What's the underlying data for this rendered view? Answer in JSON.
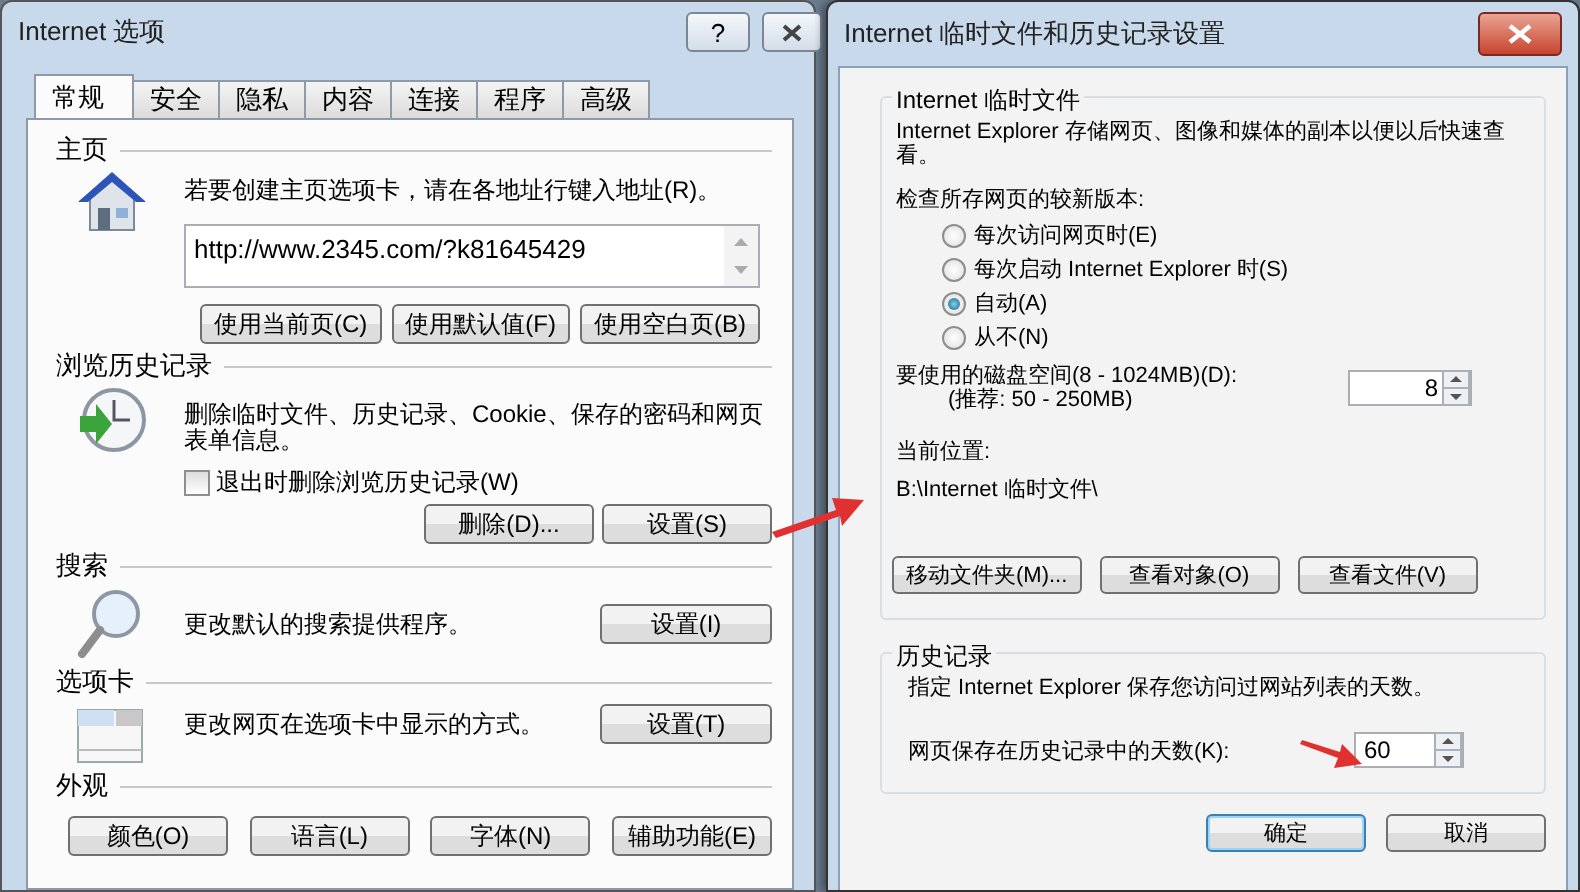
{
  "options_window": {
    "title": "Internet 选项",
    "help_button": "?",
    "tabs": [
      {
        "label": "常规",
        "selected": true
      },
      {
        "label": "安全",
        "selected": false
      },
      {
        "label": "隐私",
        "selected": false
      },
      {
        "label": "内容",
        "selected": false
      },
      {
        "label": "连接",
        "selected": false
      },
      {
        "label": "程序",
        "selected": false
      },
      {
        "label": "高级",
        "selected": false
      }
    ],
    "home_page": {
      "heading": "主页",
      "description": "若要创建主页选项卡，请在各地址行键入地址(R)。",
      "url": "http://www.2345.com/?k81645429",
      "buttons": [
        "使用当前页(C)",
        "使用默认值(F)",
        "使用空白页(B)"
      ]
    },
    "browsing_history": {
      "heading": "浏览历史记录",
      "description": "删除临时文件、历史记录、Cookie、保存的密码和网页表单信息。",
      "checkbox": {
        "label": "退出时删除浏览历史记录(W)",
        "checked": false
      },
      "buttons": [
        "删除(D)...",
        "设置(S)"
      ]
    },
    "search": {
      "heading": "搜索",
      "description": "更改默认的搜索提供程序。",
      "button": "设置(I)"
    },
    "tabs_section": {
      "heading": "选项卡",
      "description": "更改网页在选项卡中显示的方式。",
      "button": "设置(T)"
    },
    "appearance": {
      "heading": "外观",
      "buttons": [
        "颜色(O)",
        "语言(L)",
        "字体(N)",
        "辅助功能(E)"
      ]
    }
  },
  "settings_window": {
    "title": "Internet 临时文件和历史记录设置",
    "temp_files": {
      "heading": "Internet 临时文件",
      "description": "Internet Explorer 存储网页、图像和媒体的副本以便以后快速查看。",
      "check_label": "检查所存网页的较新版本:",
      "radios": [
        {
          "label": "每次访问网页时(E)",
          "selected": false
        },
        {
          "label": "每次启动 Internet Explorer 时(S)",
          "selected": false
        },
        {
          "label": "自动(A)",
          "selected": true
        },
        {
          "label": "从不(N)",
          "selected": false
        }
      ],
      "disk_space_label": "要使用的磁盘空间(8 - 1024MB)(D):",
      "recommended": "(推荐: 50 - 250MB)",
      "disk_space_value": "8",
      "location_label": "当前位置:",
      "location": "B:\\Internet 临时文件\\",
      "buttons": [
        "移动文件夹(M)...",
        "查看对象(O)",
        "查看文件(V)"
      ]
    },
    "history": {
      "heading": "历史记录",
      "description": "指定 Internet Explorer 保存您访问过网站列表的天数。",
      "days_label": "网页保存在历史记录中的天数(K):",
      "days_value": "60"
    },
    "buttons": [
      {
        "label": "确定",
        "default": true
      },
      {
        "label": "取消",
        "default": false
      }
    ]
  }
}
